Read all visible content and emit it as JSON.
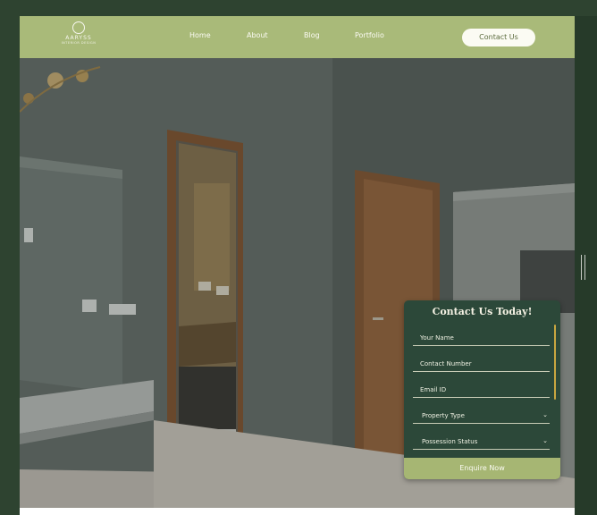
{
  "brand": {
    "name": "AARYSS",
    "tagline": "INTERIOR DESIGN"
  },
  "nav": {
    "items": [
      {
        "label": "Home"
      },
      {
        "label": "About"
      },
      {
        "label": "Blog"
      },
      {
        "label": "Portfolio"
      }
    ],
    "cta_label": "Contact Us"
  },
  "form": {
    "title": "Contact Us Today!",
    "fields": {
      "name_placeholder": "Your Name",
      "phone_placeholder": "Contact Number",
      "email_placeholder": "Email ID",
      "property_type": "Property Type",
      "possession_status": "Possession Status"
    },
    "submit_label": "Enquire Now"
  },
  "colors": {
    "header_bg": "#a9ba79",
    "form_bg": "#2c4839",
    "accent": "#a6b673",
    "page_bg": "#2e4330"
  },
  "icons": {
    "dropdown": "chevron-down-icon",
    "logo": "logo-mark-icon"
  }
}
